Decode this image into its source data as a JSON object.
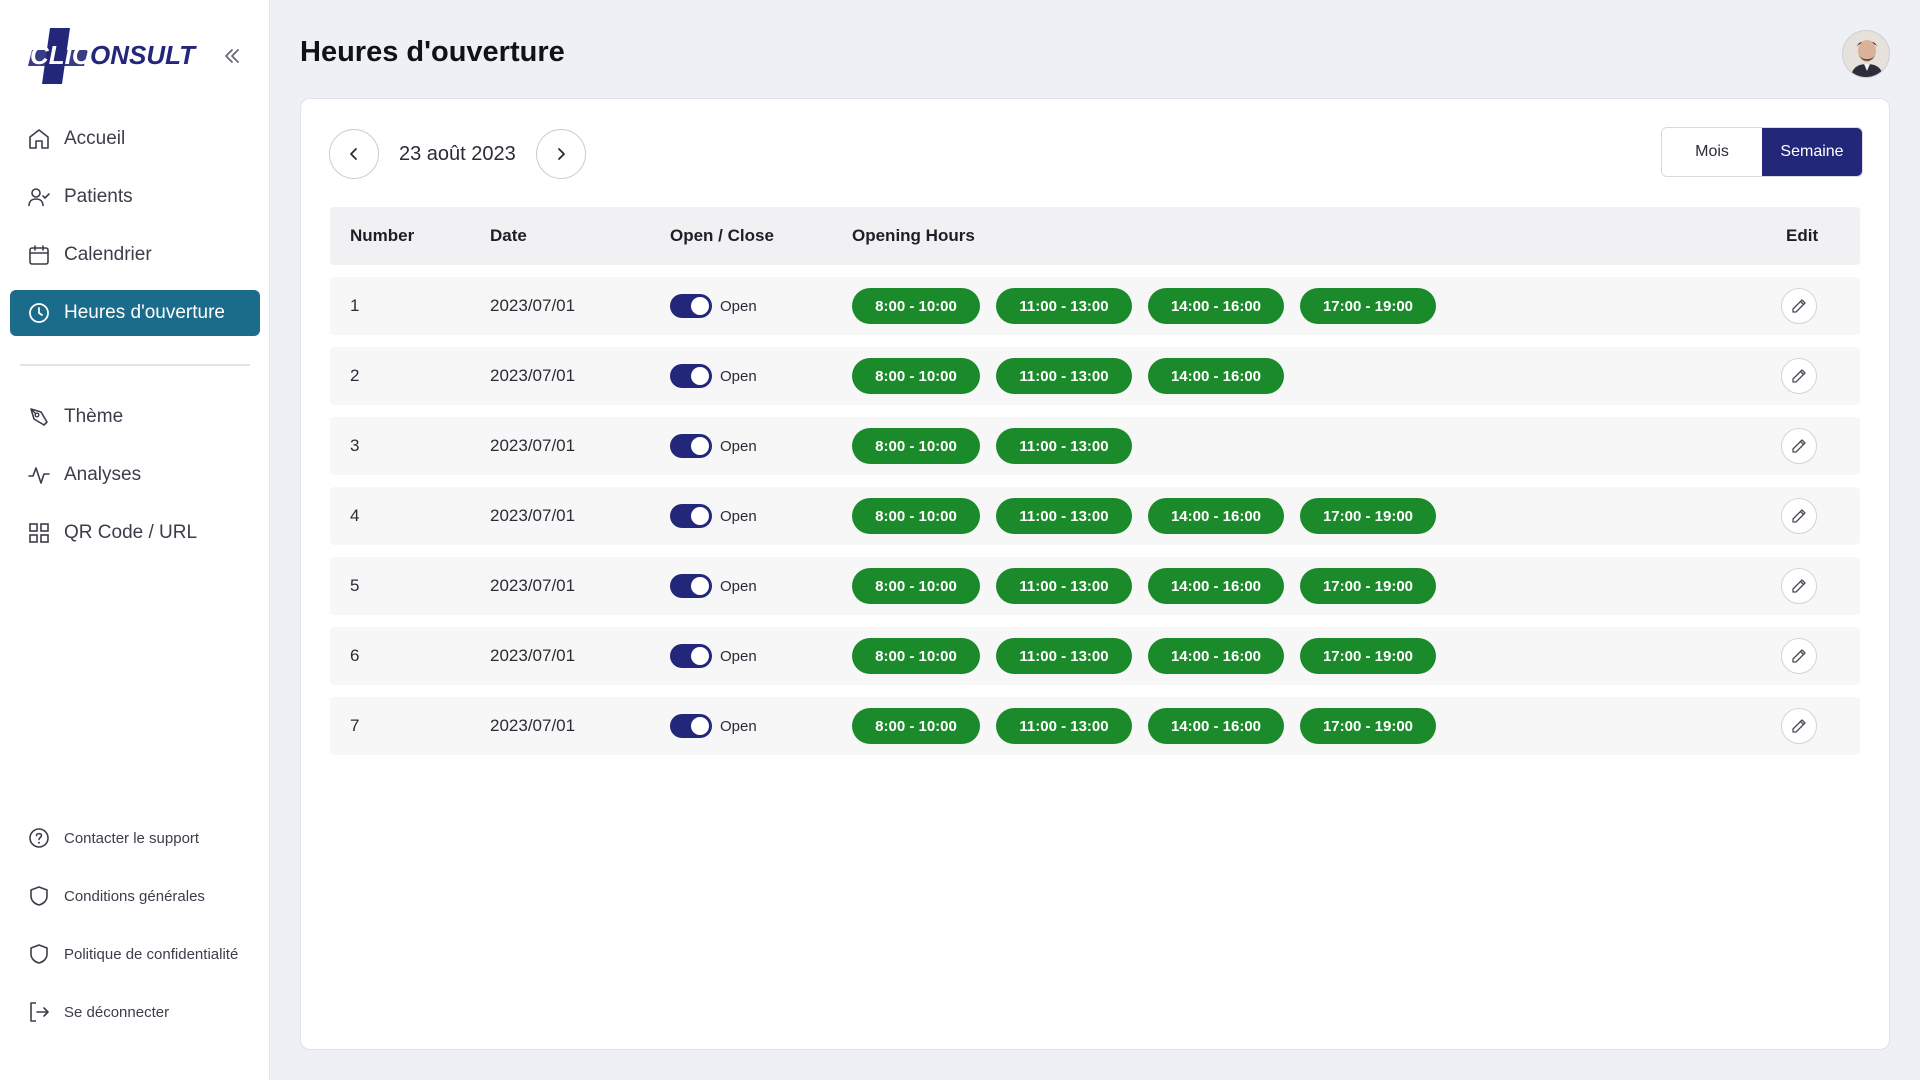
{
  "brand": {
    "logo_text": "CLICONSULT",
    "accent": "#1b6b8a",
    "primary": "#23277a",
    "slot_color": "#1b8a2a"
  },
  "sidebar": {
    "main_items": [
      {
        "label": "Accueil",
        "icon": "home-icon"
      },
      {
        "label": "Patients",
        "icon": "user-check-icon"
      },
      {
        "label": "Calendrier",
        "icon": "calendar-icon"
      },
      {
        "label": "Heures d'ouverture",
        "icon": "clock-icon",
        "active": true
      }
    ],
    "secondary_items": [
      {
        "label": "Thème",
        "icon": "pen-tool-icon"
      },
      {
        "label": "Analyses",
        "icon": "activity-icon"
      },
      {
        "label": "QR Code / URL",
        "icon": "grid-icon"
      }
    ],
    "footer_items": [
      {
        "label": "Contacter le support",
        "icon": "help-circle-icon"
      },
      {
        "label": "Conditions générales",
        "icon": "shield-icon"
      },
      {
        "label": "Politique de confidentialité",
        "icon": "shield-icon"
      },
      {
        "label": "Se déconnecter",
        "icon": "logout-icon"
      }
    ]
  },
  "header": {
    "title": "Heures d'ouverture"
  },
  "date_nav": {
    "current_date": "23 août 2023"
  },
  "view_toggle": {
    "month": "Mois",
    "week": "Semaine",
    "selected": "Semaine"
  },
  "table": {
    "headers": {
      "number": "Number",
      "date": "Date",
      "open_close": "Open / Close",
      "hours": "Opening Hours",
      "edit": "Edit"
    },
    "rows": [
      {
        "number": "1",
        "date": "2023/07/01",
        "status": "Open",
        "slots": [
          "8:00 - 10:00",
          "11:00 - 13:00",
          "14:00 - 16:00",
          "17:00 - 19:00"
        ]
      },
      {
        "number": "2",
        "date": "2023/07/01",
        "status": "Open",
        "slots": [
          "8:00 - 10:00",
          "11:00 - 13:00",
          "14:00 - 16:00"
        ]
      },
      {
        "number": "3",
        "date": "2023/07/01",
        "status": "Open",
        "slots": [
          "8:00 - 10:00",
          "11:00 - 13:00"
        ]
      },
      {
        "number": "4",
        "date": "2023/07/01",
        "status": "Open",
        "slots": [
          "8:00 - 10:00",
          "11:00 - 13:00",
          "14:00 - 16:00",
          "17:00 - 19:00"
        ]
      },
      {
        "number": "5",
        "date": "2023/07/01",
        "status": "Open",
        "slots": [
          "8:00 - 10:00",
          "11:00 - 13:00",
          "14:00 - 16:00",
          "17:00 - 19:00"
        ]
      },
      {
        "number": "6",
        "date": "2023/07/01",
        "status": "Open",
        "slots": [
          "8:00 - 10:00",
          "11:00 - 13:00",
          "14:00 - 16:00",
          "17:00 - 19:00"
        ]
      },
      {
        "number": "7",
        "date": "2023/07/01",
        "status": "Open",
        "slots": [
          "8:00 - 10:00",
          "11:00 - 13:00",
          "14:00 - 16:00",
          "17:00 - 19:00"
        ]
      }
    ]
  }
}
